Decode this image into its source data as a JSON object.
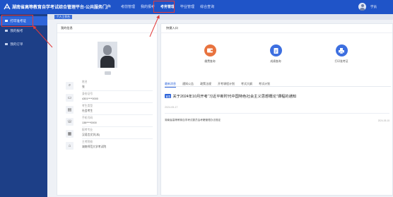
{
  "header": {
    "title": "湖南省高等教育自学考试综合管理平台-公共服务门户",
    "nav": [
      "考前管理",
      "我的报考",
      "考务管理",
      "毕业管理",
      "综合查询"
    ],
    "active_nav": "考务管理",
    "user_name": "学员"
  },
  "sidebar": {
    "items": [
      {
        "label": "打印准考证",
        "active": true
      },
      {
        "label": "我的报考",
        "active": false
      },
      {
        "label": "我的订单",
        "active": false
      }
    ]
  },
  "tab_strip": {
    "tab_label": "个人工作台"
  },
  "profile": {
    "title": "我的信息",
    "fields": [
      {
        "label": "姓名",
        "value": "张"
      },
      {
        "label": "身份证号",
        "value": "4301****0000"
      },
      {
        "label": "考生类型",
        "value": "社会考生"
      },
      {
        "label": "手机号码",
        "value": "138****0000"
      },
      {
        "label": "报考专业",
        "value": "汉语言文学(本)"
      },
      {
        "label": "主考院校",
        "value": "湖南师范大学考试院"
      }
    ]
  },
  "quick_entry": {
    "title": "快捷入口",
    "items": [
      {
        "label": "缴费查询",
        "icon": "wallet-icon",
        "color": "#e8733f"
      },
      {
        "label": "成绩查询",
        "icon": "document-icon",
        "color": "#3d6fe0"
      },
      {
        "label": "打印准考证",
        "icon": "printer-icon",
        "color": "#3d6fe0"
      }
    ]
  },
  "news": {
    "tabs": [
      "最新消息",
      "通知公告",
      "政策法规",
      "开考课程计划",
      "考试大纲",
      "考试计划"
    ],
    "active_tab": "最新消息",
    "featured": {
      "badge": "置顶",
      "title": "关于2024年10月开考“习近平新时代中国特色社会主义思想概论”课程的通知",
      "date": "2024-05-17"
    },
    "items": [
      {
        "title": "湖南省高等教育自学考试委员会考籍管理办法规定",
        "date": "2024-05-15"
      }
    ]
  },
  "colors": {
    "header": "#1f54c8",
    "sidebar": "#1d3f87",
    "accent": "#2f66da",
    "highlight": "#e23b3b"
  }
}
